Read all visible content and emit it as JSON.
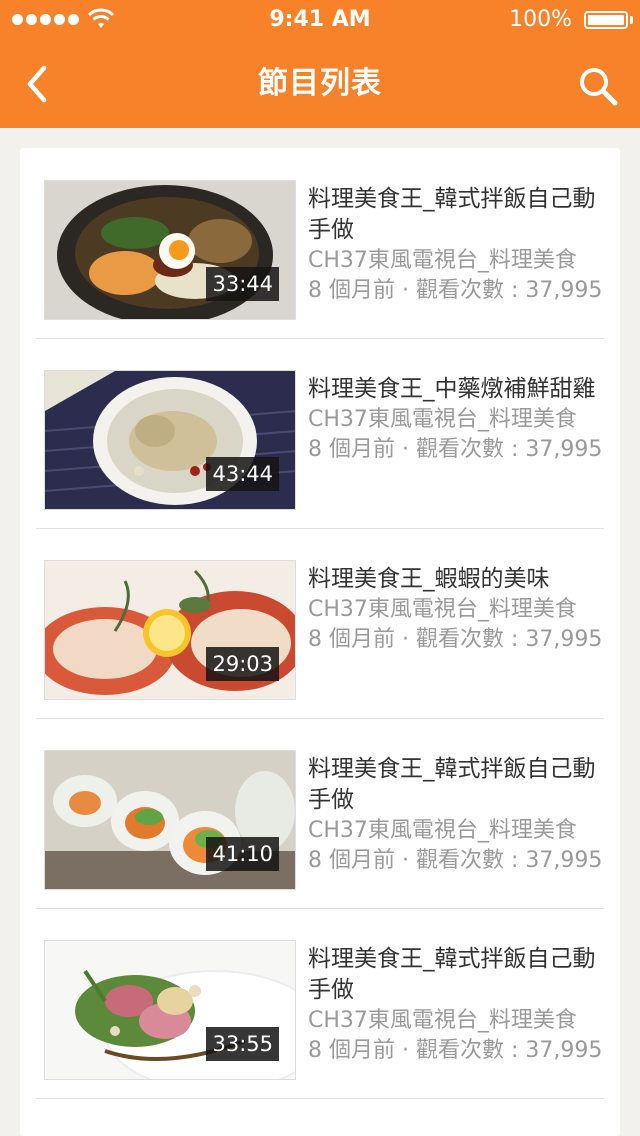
{
  "status_bar": {
    "time": "9:41 AM",
    "battery": "100%"
  },
  "nav": {
    "title": "節目列表",
    "back_icon": "chevron-left-icon",
    "search_icon": "search-icon"
  },
  "colors": {
    "brand": "#f7822a",
    "text_primary": "#333333",
    "text_secondary": "#9a9a9a"
  },
  "videos": [
    {
      "title": "料理美食王_韓式拌飯自己動手做",
      "channel": "CH37東風電視台_料理美食",
      "stats": "8 個月前 · 觀看次數 : 37,995",
      "duration": "33:44",
      "thumbnail": "bibimbap"
    },
    {
      "title": "料理美食王_中藥燉補鮮甜雞",
      "channel": "CH37東風電視台_料理美食",
      "stats": "8 個月前 · 觀看次數 : 37,995",
      "duration": "43:44",
      "thumbnail": "chicken-soup"
    },
    {
      "title": "料理美食王_蝦蝦的美味",
      "channel": "CH37東風電視台_料理美食",
      "stats": "8 個月前 · 觀看次數 : 37,995",
      "duration": "29:03",
      "thumbnail": "lobster"
    },
    {
      "title": "料理美食王_韓式拌飯自己動手做",
      "channel": "CH37東風電視台_料理美食",
      "stats": "8 個月前 · 觀看次數 : 37,995",
      "duration": "41:10",
      "thumbnail": "spring-rolls"
    },
    {
      "title": "料理美食王_韓式拌飯自己動手做",
      "channel": "CH37東風電視台_料理美食",
      "stats": "8 個月前 · 觀看次數 : 37,995",
      "duration": "33:55",
      "thumbnail": "plated-salad"
    }
  ]
}
